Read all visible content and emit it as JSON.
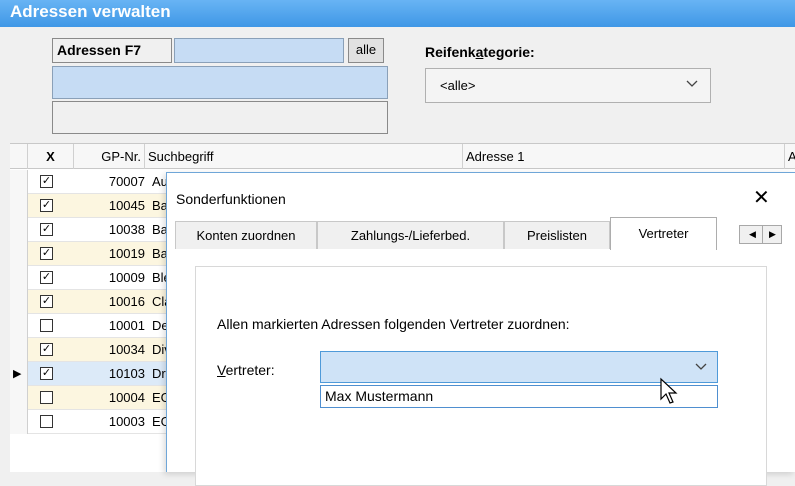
{
  "window": {
    "title": "Adressen verwalten"
  },
  "filter": {
    "adressen_label": "Adressen F7",
    "alle_button": "alle",
    "reifen_label_pre": "Reifenk",
    "reifen_label_acc": "a",
    "reifen_label_post": "tegorie:",
    "reifen_value": "<alle>"
  },
  "grid": {
    "columns": {
      "x": "X",
      "gp": "GP-Nr.",
      "such": "Suchbegriff",
      "adr1": "Adresse 1",
      "next": "A"
    },
    "rows": [
      {
        "checked": "✓",
        "gp": "70007",
        "such": "Au"
      },
      {
        "checked": "✓",
        "gp": "10045",
        "such": "Ba"
      },
      {
        "checked": "✓",
        "gp": "10038",
        "such": "Ba"
      },
      {
        "checked": "✓",
        "gp": "10019",
        "such": "Ba"
      },
      {
        "checked": "✓",
        "gp": "10009",
        "such": "Ble"
      },
      {
        "checked": "✓",
        "gp": "10016",
        "such": "Cla"
      },
      {
        "checked": "",
        "gp": "10001",
        "such": "De"
      },
      {
        "checked": "✓",
        "gp": "10034",
        "such": "Div"
      },
      {
        "checked": "✓",
        "gp": "10103",
        "such": "Dri"
      },
      {
        "checked": "",
        "gp": "10004",
        "such": "EG"
      },
      {
        "checked": "",
        "gp": "10003",
        "such": "EG"
      }
    ],
    "current_row_marker": "▶"
  },
  "dialog": {
    "title": "Sonderfunktionen",
    "close": "✕",
    "tabs": [
      "Konten zuordnen",
      "Zahlungs-/Lieferbed.",
      "Preislisten",
      "Vertreter"
    ],
    "tab_prev": "◀",
    "tab_next": "▶",
    "instruction": "Allen markierten Adressen folgenden Vertreter zuordnen:",
    "vertreter_label_acc": "V",
    "vertreter_label_rest": "ertreter:",
    "vertreter_value": "",
    "dropdown_option": "Max Mustermann"
  },
  "colors": {
    "title_bar": "#3f97e6",
    "selected_input": "#c6dcf4",
    "alt_row": "#fcf6e0"
  }
}
